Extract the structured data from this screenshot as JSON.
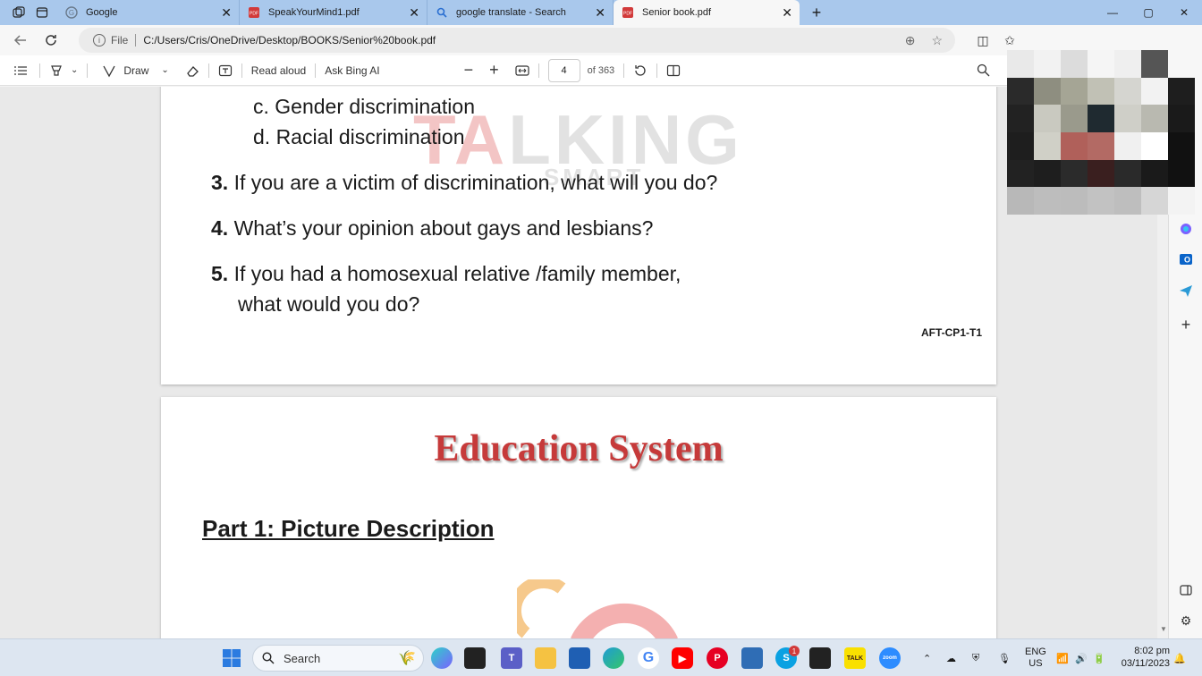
{
  "tabs": [
    {
      "title": "Google",
      "icon": "google-icon",
      "active": false
    },
    {
      "title": "SpeakYourMind1.pdf",
      "icon": "pdf-icon",
      "active": false
    },
    {
      "title": "google translate - Search",
      "icon": "search-icon",
      "active": false
    },
    {
      "title": "Senior book.pdf",
      "icon": "pdf-icon",
      "active": true
    }
  ],
  "address": {
    "scheme": "File",
    "url": "C:/Users/Cris/OneDrive/Desktop/BOOKS/Senior%20book.pdf"
  },
  "pdf_toolbar": {
    "draw": "Draw",
    "read_aloud": "Read aloud",
    "ask_bing": "Ask Bing AI",
    "page": "4",
    "of_pages": "of 363"
  },
  "page1": {
    "lines": [
      {
        "num": "",
        "text": "c. Gender discrimination"
      },
      {
        "num": "",
        "text": "d. Racial discrimination"
      },
      {
        "num": "3.",
        "text": "If you are a victim of discrimination, what will you do?"
      },
      {
        "num": "4.",
        "text": "What’s your opinion about gays and lesbians?"
      },
      {
        "num": "5.",
        "text": "If you had a homosexual relative /family member,"
      },
      {
        "num": "",
        "text": "what would you do?"
      }
    ],
    "footer_code": "AFT-CP1-T1",
    "watermark": "TALKING",
    "watermark_sub": "SMART"
  },
  "page2": {
    "title": "Education System",
    "part": "Part 1: Picture Description"
  },
  "taskbar": {
    "search_placeholder": "Search",
    "lang_line1": "ENG",
    "lang_line2": "US",
    "time": "8:02 pm",
    "date": "03/11/2023",
    "skype_badge": "1"
  },
  "colors": {
    "tabstrip": "#a9c8ec",
    "title_red": "#c63a3a",
    "taskbar": "#dde6f1"
  }
}
